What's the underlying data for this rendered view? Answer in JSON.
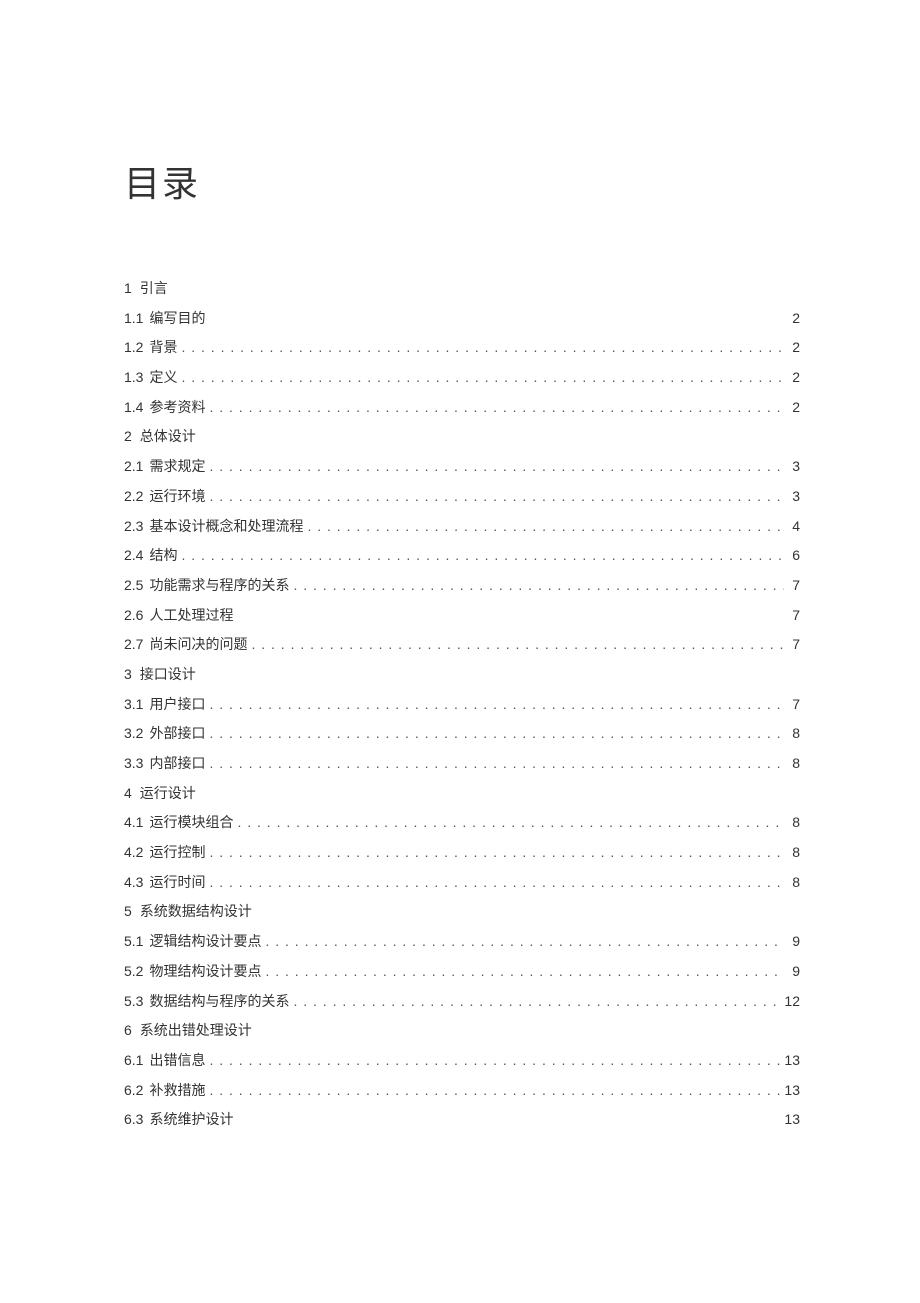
{
  "title": "目录",
  "toc": [
    {
      "number": "1",
      "text": "引言",
      "page": "",
      "leader": false,
      "section": true
    },
    {
      "number": "1.1",
      "text": "编写目的",
      "page": "2",
      "leader": false,
      "section": false
    },
    {
      "number": "1.2",
      "text": "背景",
      "page": "2",
      "leader": true,
      "section": false
    },
    {
      "number": "1.3",
      "text": "定义",
      "page": "2",
      "leader": true,
      "section": false
    },
    {
      "number": "1.4",
      "text": "参考资料",
      "page": "2",
      "leader": true,
      "section": false
    },
    {
      "number": "2",
      "text": "总体设计",
      "page": "",
      "leader": false,
      "section": true
    },
    {
      "number": "2.1",
      "text": "需求规定",
      "page": "3",
      "leader": true,
      "section": false
    },
    {
      "number": "2.2",
      "text": "运行环境",
      "page": "3",
      "leader": true,
      "section": false
    },
    {
      "number": "2.3",
      "text": "基本设计概念和处理流程",
      "page": "4",
      "leader": true,
      "section": false
    },
    {
      "number": "2.4",
      "text": "结构",
      "page": "6",
      "leader": true,
      "section": false
    },
    {
      "number": "2.5",
      "text": "功能需求与程序的关系",
      "page": "7",
      "leader": true,
      "section": false
    },
    {
      "number": "2.6",
      "text": "人工处理过程",
      "page": "7",
      "leader": false,
      "section": false
    },
    {
      "number": "2.7",
      "text": "尚未问决的问题",
      "page": "7",
      "leader": true,
      "section": false
    },
    {
      "number": "3",
      "text": "接口设计",
      "page": "",
      "leader": false,
      "section": true
    },
    {
      "number": "3.1",
      "text": "用户接口",
      "page": "7",
      "leader": true,
      "section": false
    },
    {
      "number": "3.2",
      "text": "外部接口",
      "page": "8",
      "leader": true,
      "section": false
    },
    {
      "number": "3.3",
      "text": "内部接口",
      "page": "8",
      "leader": true,
      "section": false
    },
    {
      "number": "4",
      "text": "运行设计",
      "page": "",
      "leader": false,
      "section": true
    },
    {
      "number": "4.1",
      "text": "运行模块组合",
      "page": "8",
      "leader": true,
      "section": false
    },
    {
      "number": "4.2",
      "text": "运行控制",
      "page": "8",
      "leader": true,
      "section": false
    },
    {
      "number": "4.3",
      "text": "运行时间",
      "page": "8",
      "leader": true,
      "section": false
    },
    {
      "number": "5",
      "text": "系统数据结构设计",
      "page": "",
      "leader": false,
      "section": true
    },
    {
      "number": "5.1",
      "text": "逻辑结构设计要点",
      "page": "9",
      "leader": true,
      "section": false
    },
    {
      "number": "5.2",
      "text": "物理结构设计要点",
      "page": "9",
      "leader": true,
      "section": false
    },
    {
      "number": "5.3",
      "text": "数据结构与程序的关系",
      "page": "12",
      "leader": true,
      "section": false
    },
    {
      "number": "6",
      "text": "系统出错处理设计",
      "page": "",
      "leader": false,
      "section": true
    },
    {
      "number": "6.1",
      "text": "出错信息",
      "page": "13",
      "leader": true,
      "section": false
    },
    {
      "number": "6.2",
      "text": "补救措施",
      "page": "13",
      "leader": true,
      "section": false
    },
    {
      "number": "6.3",
      "text": "系统维护设计",
      "page": "13",
      "leader": false,
      "section": false
    }
  ],
  "leader_dots": ". . . . . . . . . . . . . . . . . . . . . . . . . . . . . . . . . . . . . . . . . . . . . . . . . . . . . . . . . . . . . . . . . . . . . . . . . . . . . . . . . . . . . . . . . . . . . . . . . . . . . . . . . . . . . . . . . . . . . . . ."
}
